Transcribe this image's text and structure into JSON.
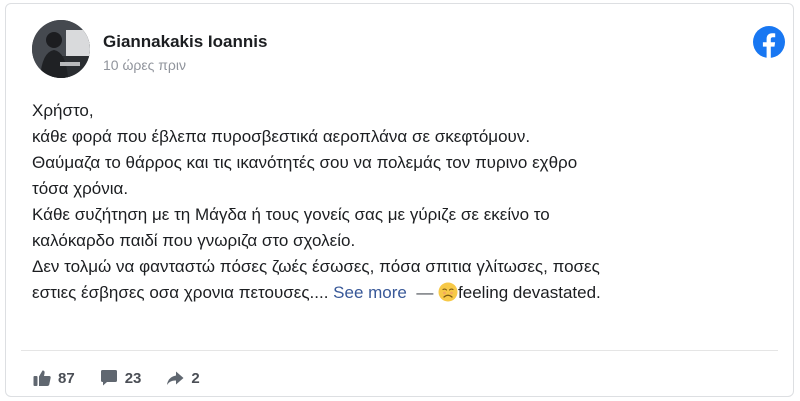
{
  "post": {
    "author": "Giannakakis Ioannis",
    "timestamp": "10 ώρες πριν",
    "lines": [
      "Χρήστο,",
      "κάθε φορά που έβλεπα πυροσβεστικά αεροπλάνα σε σκεφτόμουν.",
      "Θαύμαζα το θάρρος και τις ικανότητές σου να πολεμάς τον πυρινο εχθρο",
      "τόσα χρόνια.",
      "Κάθε συζήτηση με τη Μάγδα ή τους γονείς σας με γύριζε σε εκείνο το",
      "καλόκαρδο παιδί που γνωριζα στο σχολείο.",
      "Δεν τολμώ να φανταστώ πόσες ζωές έσωσες, πόσα σπιτια γλίτωσες, ποσες"
    ],
    "last_line": "εστιες έσβησες οσα χρονια πετουσες....",
    "see_more": "See more",
    "dash": "—",
    "feeling_emoji": "sad-face-icon",
    "feeling": "feeling devastated."
  },
  "stats": {
    "likes": "87",
    "comments": "23",
    "shares": "2"
  },
  "colors": {
    "facebook_blue": "#1877f2",
    "link": "#385898",
    "muted": "#90949c",
    "stats": "#4b4f56"
  }
}
